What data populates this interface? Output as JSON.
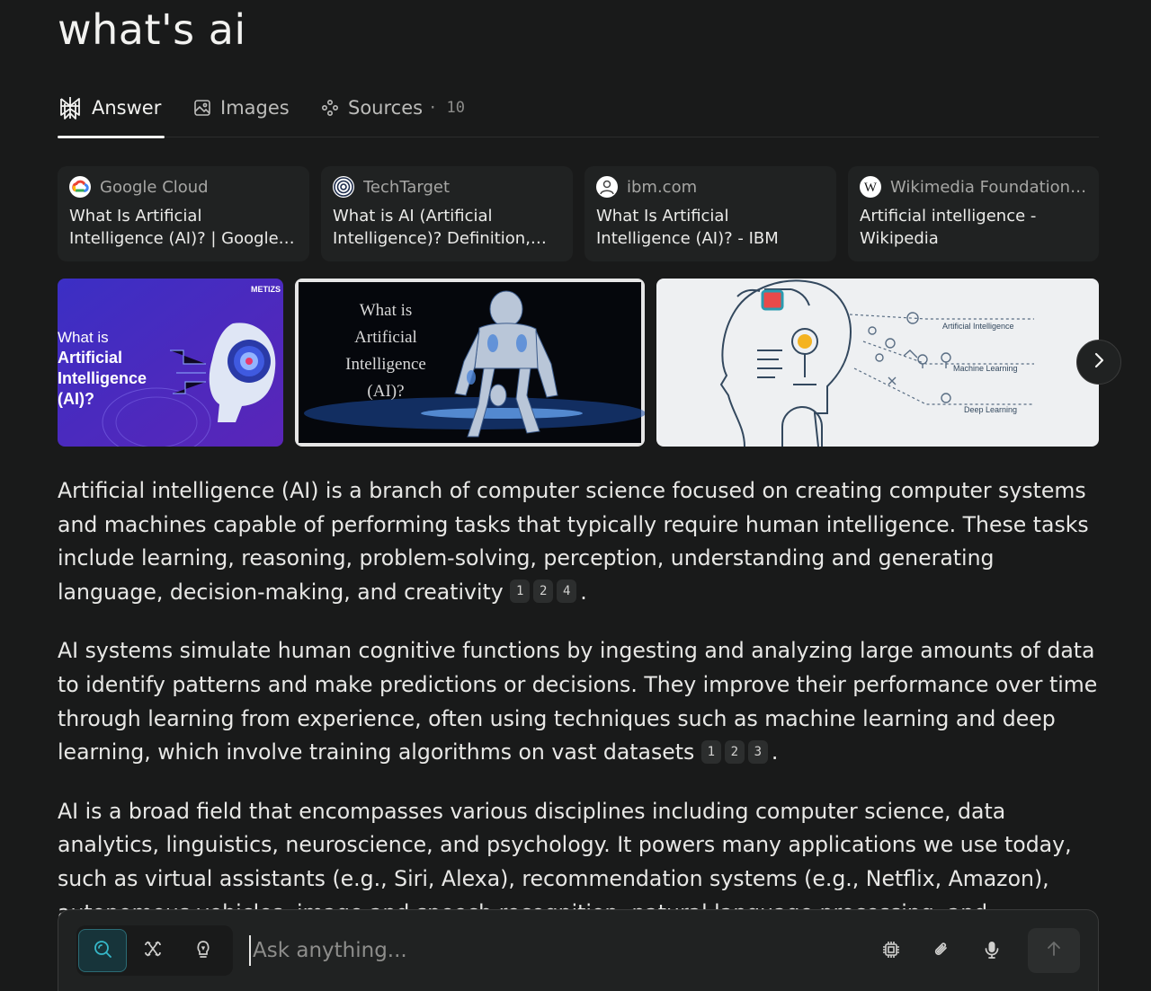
{
  "query": "what's ai",
  "tabs": [
    {
      "label": "Answer",
      "icon": "perplexity-icon",
      "active": true
    },
    {
      "label": "Images",
      "icon": "image-icon"
    },
    {
      "label": "Sources",
      "icon": "sources-icon",
      "count": "· 10"
    }
  ],
  "source_cards": [
    {
      "source": "Google Cloud",
      "title": "What Is Artificial Intelligence (AI)? | Google Cloud",
      "icon": "google-cloud-icon"
    },
    {
      "source": "TechTarget",
      "title": "What is AI (Artificial Intelligence)? Definition, Types",
      "icon": "techtarget-icon"
    },
    {
      "source": "ibm.com",
      "title": "What Is Artificial Intelligence (AI)? - IBM",
      "icon": "ibm-icon"
    },
    {
      "source": "Wikimedia Foundation, Inc.",
      "title": "Artificial intelligence - Wikipedia",
      "icon": "wikipedia-icon"
    }
  ],
  "images": {
    "img1": {
      "brand": "METIZS",
      "line1": "What is",
      "line2": "Artificial",
      "line3": "Intelligence",
      "line4": "(AI)?"
    },
    "img2": {
      "line1": "What is",
      "line2": "Artificial",
      "line3": "Intelligence",
      "line4": "(AI)?"
    },
    "img3": {
      "label1": "Artificial Intelligence",
      "label2": "Machine Learning",
      "label3": "Deep Learning"
    }
  },
  "answer": {
    "p1": {
      "text": "Artificial intelligence (AI) is a branch of computer science focused on creating computer systems and machines capable of performing tasks that typically require human intelligence. These tasks include learning, reasoning, problem-solving, perception, understanding and generating language, decision-making, and creativity",
      "citations": [
        "1",
        "2",
        "4"
      ],
      "end": "."
    },
    "p2": {
      "text": "AI systems simulate human cognitive functions by ingesting and analyzing large amounts of data to identify patterns and make predictions or decisions. They improve their performance over time through learning from experience, often using techniques such as machine learning and deep learning, which involve training algorithms on vast datasets",
      "citations": [
        "1",
        "2",
        "3"
      ],
      "end": "."
    },
    "p3": {
      "text": "AI is a broad field that encompasses various disciplines including computer science, data analytics, linguistics, neuroscience, and psychology. It powers many applications we use today, such as virtual assistants (e.g., Siri, Alexa), recommendation systems (e.g., Netflix, Amazon), autonomous vehicles, image and speech recognition, natural language processing, and generative AI tools"
    }
  },
  "composer": {
    "placeholder": "Ask anything...",
    "modes": [
      "search-icon",
      "research-icon",
      "lightbulb-icon"
    ],
    "tools": [
      "chip-icon",
      "paperclip-icon",
      "microphone-icon"
    ],
    "send_icon": "arrow-up-icon"
  },
  "colors": {
    "background": "#191a1a",
    "card": "#202222",
    "accent": "#2b6b75",
    "text": "#e8e8e6"
  }
}
